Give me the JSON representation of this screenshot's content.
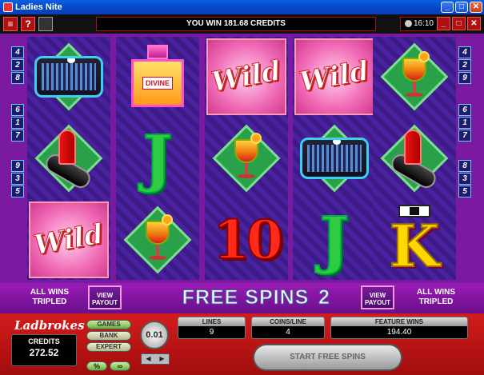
{
  "window": {
    "title": "Ladies Nite",
    "min_icon": "_",
    "max_icon": "□",
    "close_icon": "✕"
  },
  "topbar": {
    "menu_icon": "≡",
    "help_icon": "?",
    "message": "YOU WIN 181.68 CREDITS",
    "time": "16:10",
    "minimize_icon": "_",
    "restore_icon": "□",
    "close_icon": "✕"
  },
  "paylines": {
    "left": [
      "4",
      "2",
      "8",
      "6",
      "1",
      "7",
      "9",
      "3",
      "5"
    ],
    "right": [
      "4",
      "2",
      "9",
      "6",
      "1",
      "7",
      "8",
      "3",
      "5"
    ]
  },
  "reels": [
    [
      "handbag",
      "lipstick",
      "wild"
    ],
    [
      "perfume",
      "j",
      "cocktail"
    ],
    [
      "wild",
      "cocktail",
      "ten"
    ],
    [
      "wild",
      "handbag",
      "j"
    ],
    [
      "cocktail",
      "lipstick",
      "k"
    ]
  ],
  "symbols": {
    "wild_text": "Wild",
    "perfume_label": "DIVINE",
    "j_text": "J",
    "ten_text": "10",
    "k_text": "K"
  },
  "banner": {
    "left_text": "ALL WINS TRIPLED",
    "right_text": "ALL WINS TRIPLED",
    "view_payout": "VIEW PAYOUT",
    "free_spins_label": "FREE SPINS",
    "free_spins_count": "2"
  },
  "panel": {
    "brand": "Ladbrokes",
    "credits_label": "CREDITS",
    "credits_value": "272.52",
    "games_btn": "GAMES",
    "bank_btn": "BANK",
    "expert_btn": "EXPERT",
    "percent_btn": "%",
    "infinity_btn": "∞",
    "coin_value": "0.01",
    "coin_down": "◀",
    "coin_up": "▶",
    "lines_label": "LINES",
    "lines_value": "9",
    "coins_label": "COINS/LINE",
    "coins_value": "4",
    "feature_label": "FEATURE WINS",
    "feature_value": "194.40",
    "start_btn": "START FREE SPINS"
  }
}
